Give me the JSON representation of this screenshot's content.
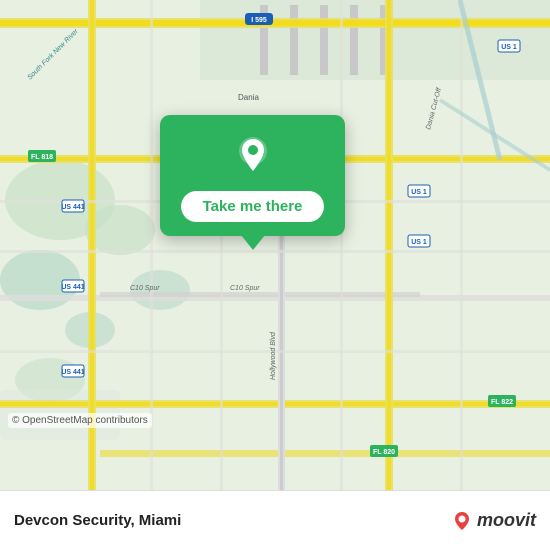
{
  "map": {
    "attribution": "© OpenStreetMap contributors"
  },
  "card": {
    "button_label": "Take me there"
  },
  "bottom_bar": {
    "title": "Devcon Security",
    "subtitle": "Miami"
  },
  "moovit": {
    "label": "moovit"
  }
}
